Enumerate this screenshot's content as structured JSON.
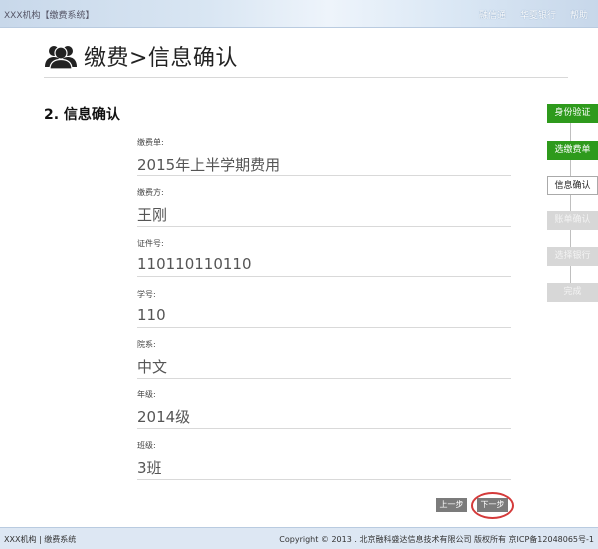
{
  "top": {
    "brand": "XXX机构【缴费系统】",
    "nav": [
      "融信通",
      "华夏银行",
      "帮助"
    ]
  },
  "page_title": "缴费>信息确认",
  "section_title": "2. 信息确认",
  "fields": [
    {
      "label": "缴费单:",
      "value": "2015年上半学期费用"
    },
    {
      "label": "缴费方:",
      "value": "王刚"
    },
    {
      "label": "证件号:",
      "value": "110110110110"
    },
    {
      "label": "学号:",
      "value": "110"
    },
    {
      "label": "院系:",
      "value": "中文"
    },
    {
      "label": "年级:",
      "value": "2014级"
    },
    {
      "label": "班级:",
      "value": "3班"
    }
  ],
  "steps": [
    {
      "label": "身份验证",
      "state": "done"
    },
    {
      "label": "选缴费单",
      "state": "done"
    },
    {
      "label": "信息确认",
      "state": "current"
    },
    {
      "label": "账单确认",
      "state": "todo"
    },
    {
      "label": "选择银行",
      "state": "todo"
    },
    {
      "label": "完成",
      "state": "todo"
    }
  ],
  "buttons": {
    "prev": "上一步",
    "next": "下一步"
  },
  "footer": {
    "left": "XXX机构 | 缴费系统",
    "right": "Copyright © 2013 . 北京融科盛达信息技术有限公司 版权所有 京ICP备12048065号-1"
  }
}
